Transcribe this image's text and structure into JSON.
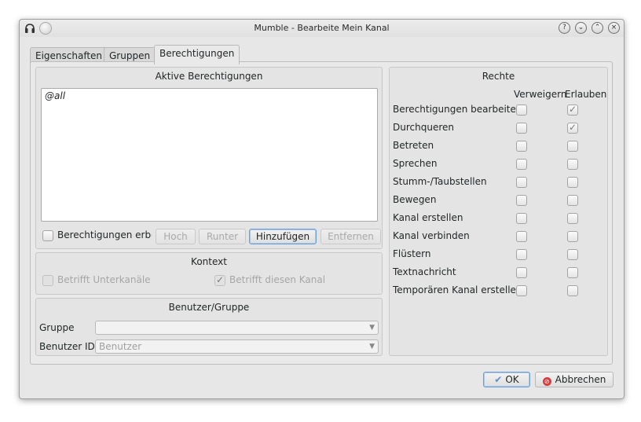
{
  "window": {
    "title": "Mumble - Bearbeite Mein Kanal",
    "wm_help": "?",
    "wm_min": "⌄",
    "wm_max": "⌃",
    "wm_close": "×"
  },
  "tabs": [
    {
      "label": "Eigenschaften",
      "active": false
    },
    {
      "label": "Gruppen",
      "active": false
    },
    {
      "label": "Berechtigungen",
      "active": true
    }
  ],
  "active_permissions": {
    "title": "Aktive Berechtigungen",
    "items": [
      "@all"
    ],
    "inherit_label": "Berechtigungen erben",
    "buttons": {
      "up": "Hoch",
      "down": "Runter",
      "add": "Hinzufügen",
      "remove": "Entfernen"
    }
  },
  "context": {
    "title": "Kontext",
    "sub_channels": {
      "label": "Betrifft Unterkanäle",
      "checked": false
    },
    "this_channel": {
      "label": "Betrifft diesen Kanal",
      "checked": true
    }
  },
  "user_group": {
    "title": "Benutzer/Gruppe",
    "group_label": "Gruppe",
    "group_value": "",
    "user_id_label": "Benutzer ID",
    "user_placeholder": "Benutzer"
  },
  "rights": {
    "title": "Rechte",
    "col_deny": "Verweigern",
    "col_allow": "Erlauben",
    "rows": [
      {
        "label": "Berechtigungen bearbeiten",
        "deny": false,
        "allow": true
      },
      {
        "label": "Durchqueren",
        "deny": false,
        "allow": true
      },
      {
        "label": "Betreten",
        "deny": false,
        "allow": false
      },
      {
        "label": "Sprechen",
        "deny": false,
        "allow": false
      },
      {
        "label": "Stumm-/Taubstellen",
        "deny": false,
        "allow": false
      },
      {
        "label": "Bewegen",
        "deny": false,
        "allow": false
      },
      {
        "label": "Kanal erstellen",
        "deny": false,
        "allow": false
      },
      {
        "label": "Kanal verbinden",
        "deny": false,
        "allow": false
      },
      {
        "label": "Flüstern",
        "deny": false,
        "allow": false
      },
      {
        "label": "Textnachricht",
        "deny": false,
        "allow": false
      },
      {
        "label": "Temporären Kanal erstellen",
        "deny": false,
        "allow": false
      }
    ]
  },
  "dialog_buttons": {
    "ok": "OK",
    "cancel": "Abbrechen"
  },
  "colors": {
    "accent": "#6c9ed3",
    "cancel_icon": "#d63a3a"
  }
}
